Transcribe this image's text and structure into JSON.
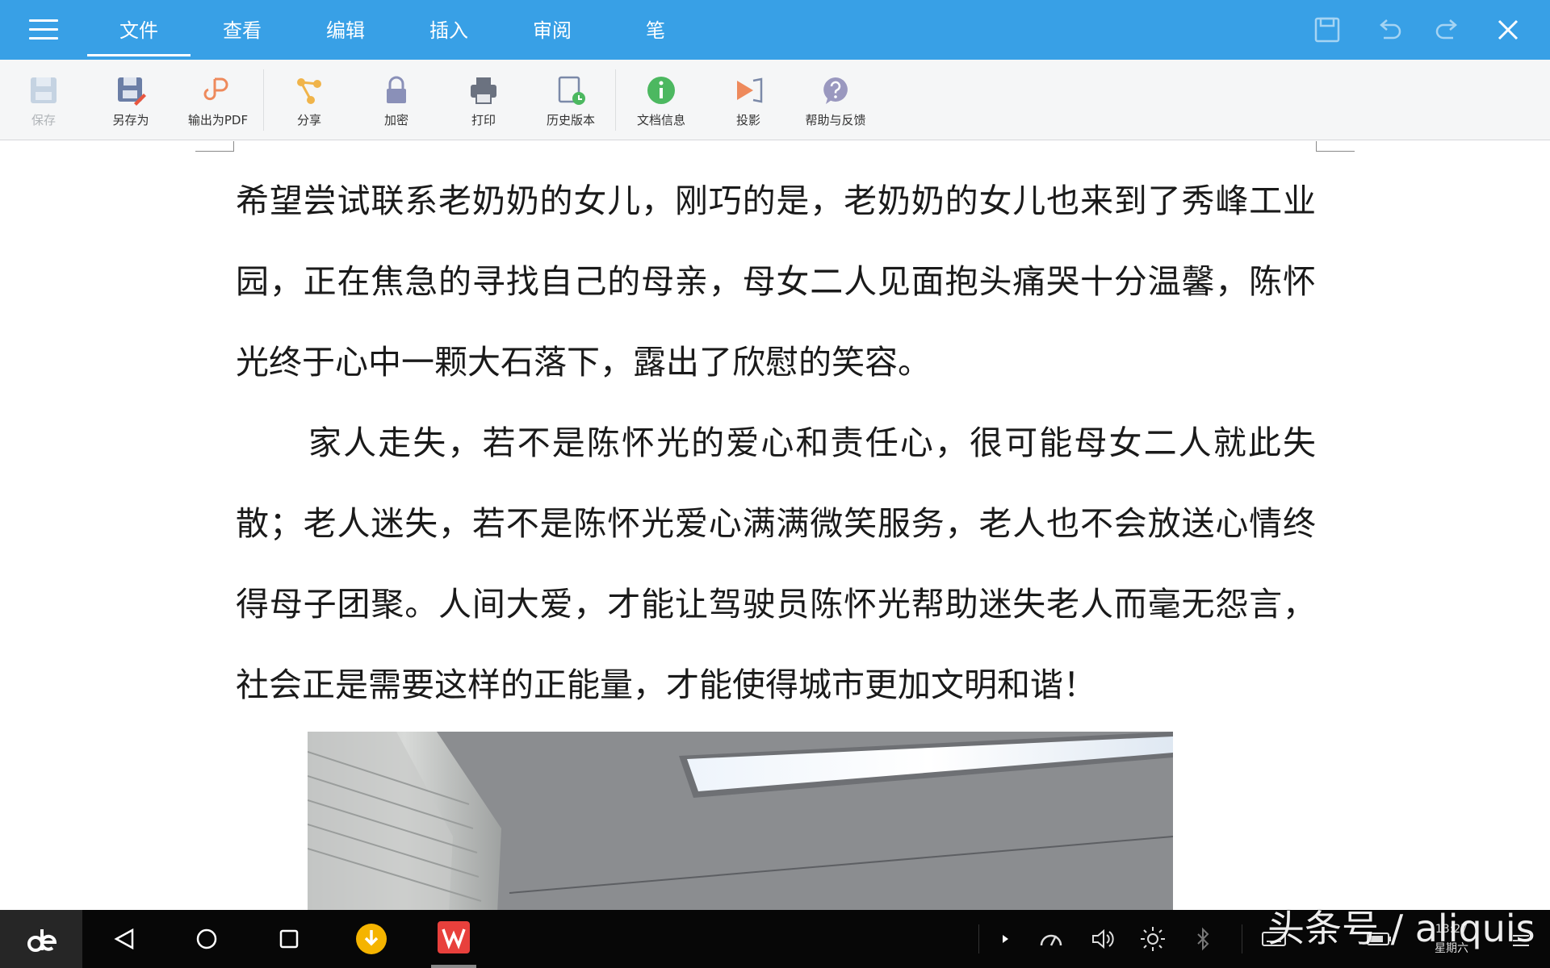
{
  "app": {
    "tabs": [
      {
        "label": "文件",
        "active": true
      },
      {
        "label": "查看",
        "active": false
      },
      {
        "label": "编辑",
        "active": false
      },
      {
        "label": "插入",
        "active": false
      },
      {
        "label": "审阅",
        "active": false
      },
      {
        "label": "笔",
        "active": false
      }
    ],
    "accent_color": "#38a0e6"
  },
  "ribbon": {
    "tools": [
      {
        "label": "保存",
        "icon": "save-icon",
        "disabled": true
      },
      {
        "label": "另存为",
        "icon": "save-as-icon",
        "disabled": false
      },
      {
        "label": "输出为PDF",
        "icon": "export-pdf-icon",
        "disabled": false
      },
      {
        "label": "分享",
        "icon": "share-icon",
        "disabled": false
      },
      {
        "label": "加密",
        "icon": "lock-icon",
        "disabled": false
      },
      {
        "label": "打印",
        "icon": "printer-icon",
        "disabled": false
      },
      {
        "label": "历史版本",
        "icon": "history-icon",
        "disabled": false
      },
      {
        "label": "文档信息",
        "icon": "info-icon",
        "disabled": false
      },
      {
        "label": "投影",
        "icon": "projector-icon",
        "disabled": false
      },
      {
        "label": "帮助与反馈",
        "icon": "help-icon",
        "disabled": false
      }
    ]
  },
  "document": {
    "paragraphs": [
      "希望尝试联系老奶奶的女儿，刚巧的是，老奶奶的女儿也来到了秀峰工业园，正在焦急的寻找自己的母亲，母女二人见面抱头痛哭十分温馨，陈怀光终于心中一颗大石落下，露出了欣慰的笑容。",
      "家人走失，若不是陈怀光的爱心和责任心，很可能母女二人就此失散；老人迷失，若不是陈怀光爱心满满微笑服务，老人也不会放送心情终得母子团聚。人间大爱，才能让驾驶员陈怀光帮助迷失老人而毫无怨言，社会正是需要这样的正能量，才能使得城市更加文明和谐！"
    ]
  },
  "taskbar": {
    "clock_time": "13:27",
    "clock_day": "星期六",
    "watermark": "头条号 / aliquis"
  }
}
